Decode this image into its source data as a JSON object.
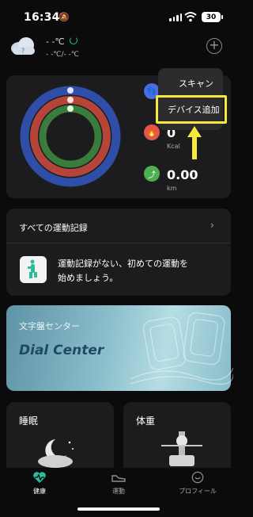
{
  "status": {
    "time": "16:34",
    "battery": "30"
  },
  "weather": {
    "temp": "- -℃",
    "range": "- -℃/- -℃"
  },
  "stats": [
    {
      "value": "",
      "unit": "",
      "color": "#4a6de5"
    },
    {
      "value": "0",
      "unit": "Kcal",
      "color": "#e2574c"
    },
    {
      "value": "0.00",
      "unit": "km",
      "color": "#4caf50"
    }
  ],
  "rings": {
    "outer": "#2f4ea8",
    "middle": "#b5453a",
    "inner": "#3a7c3c"
  },
  "menu": {
    "scan": "スキャン",
    "add_device": "デバイス追加"
  },
  "records": {
    "title": "すべての運動記録",
    "message_line1": "運動記録がない、初めての運動を",
    "message_line2": "始めましょう。"
  },
  "dial": {
    "jp": "文字盤センター",
    "en": "Dial Center"
  },
  "sleep": {
    "title": "睡眠"
  },
  "weight": {
    "title": "体重"
  },
  "tabs": [
    {
      "label": "健康",
      "icon": "heart-icon",
      "active": true
    },
    {
      "label": "運動",
      "icon": "shoe-icon",
      "active": false
    },
    {
      "label": "プロフィール",
      "icon": "face-icon",
      "active": false
    }
  ],
  "colors": {
    "accent": "#2dbb9a",
    "highlight": "#f5ea3a"
  }
}
